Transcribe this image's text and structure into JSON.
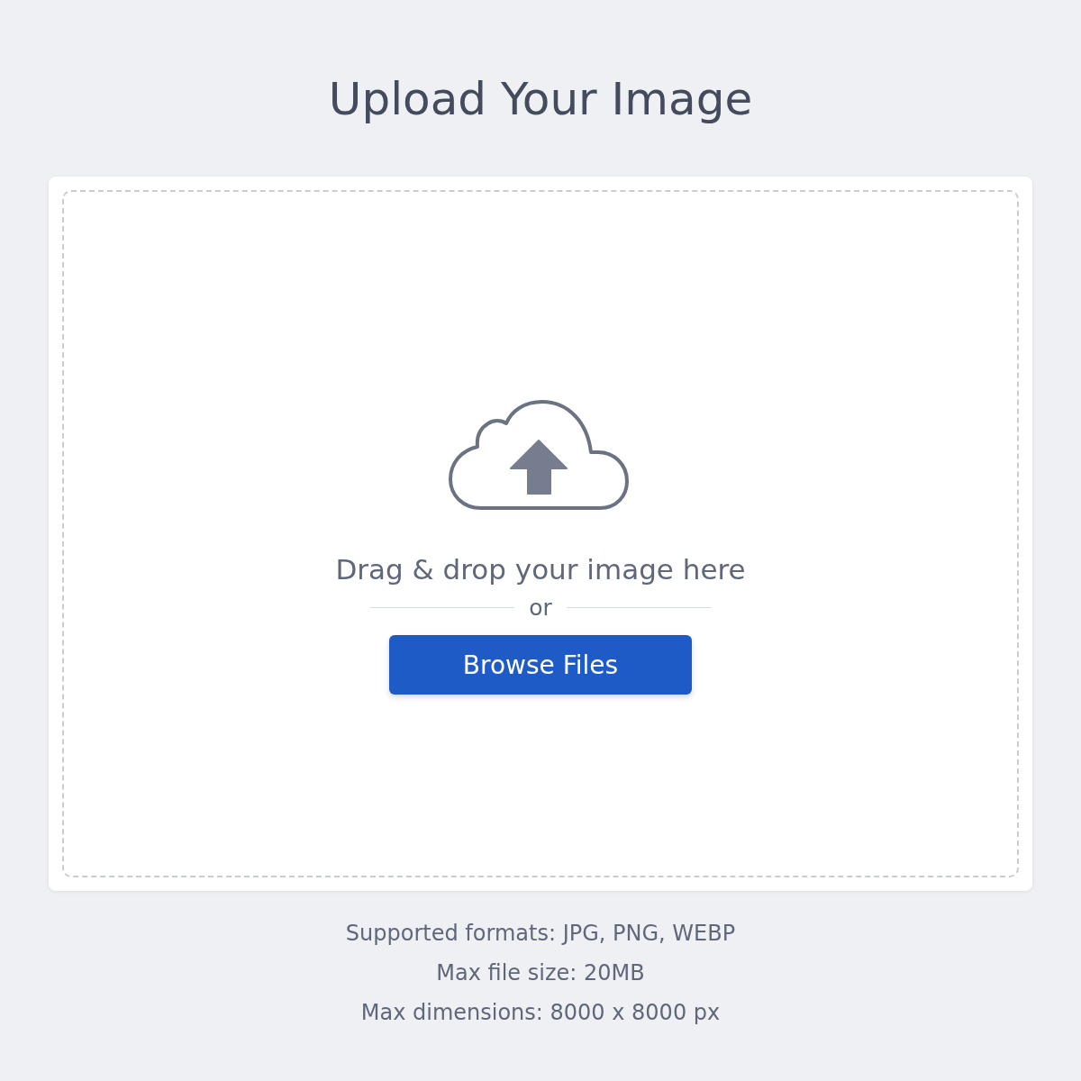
{
  "title": "Upload Your Image",
  "dropzone": {
    "prompt": "Drag & drop your image here",
    "separator": "or",
    "button": "Browse Files"
  },
  "notes": [
    "Supported formats: JPG, PNG, WEBP",
    "Max file size: 20MB",
    "Max dimensions: 8000 x 8000 px"
  ]
}
